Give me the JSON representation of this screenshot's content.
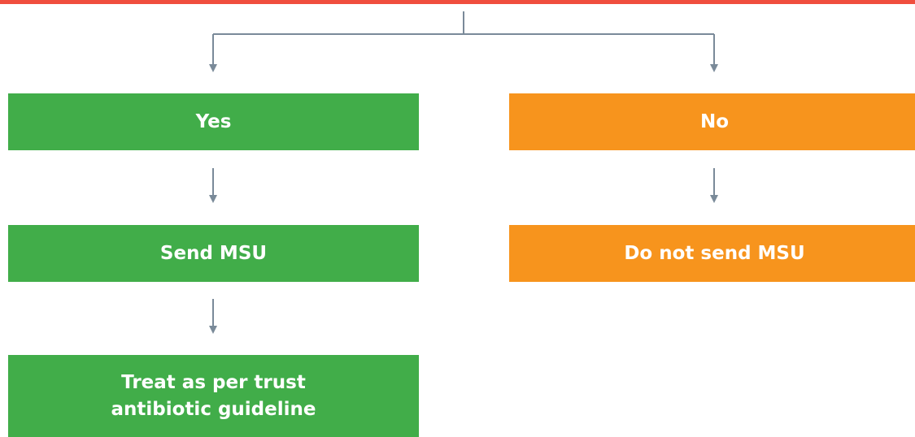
{
  "colors": {
    "top_bar": "#f04e3e",
    "yes": "#41ad49",
    "no": "#f7941d",
    "connector": "#7a8a99"
  },
  "nodes": {
    "yes": "Yes",
    "no": "No",
    "send_msu": "Send MSU",
    "do_not_send_msu": "Do not send MSU",
    "treat": "Treat as per trust\nantibiotic guideline"
  }
}
